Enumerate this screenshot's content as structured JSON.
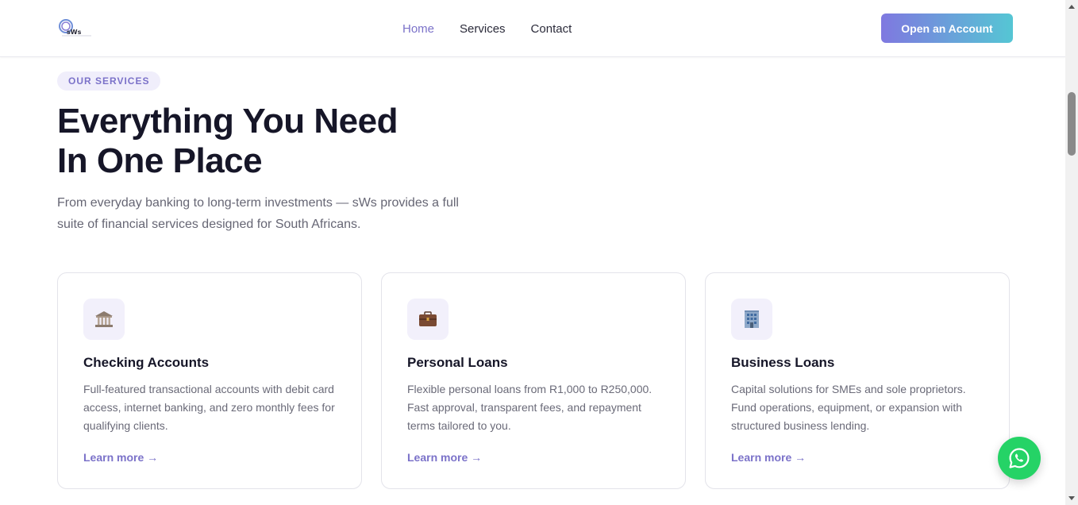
{
  "header": {
    "logo_text": "sWs",
    "nav": [
      {
        "label": "Home",
        "active": true
      },
      {
        "label": "Services",
        "active": false
      },
      {
        "label": "Contact",
        "active": false
      }
    ],
    "cta_label": "Open an Account"
  },
  "section": {
    "badge": "OUR SERVICES",
    "headline_line1": "Everything You Need",
    "headline_line2": "In One Place",
    "intro": "From everyday banking to long-term investments — sWs provides a full suite of financial services designed for South Africans."
  },
  "cards": [
    {
      "icon": "bank-icon",
      "title": "Checking Accounts",
      "description": "Full-featured transactional accounts with debit card access, internet banking, and zero monthly fees for qualifying clients.",
      "link": "Learn more →"
    },
    {
      "icon": "briefcase-icon",
      "title": "Personal Loans",
      "description": "Flexible personal loans from R1,000 to R250,000. Fast approval, transparent fees, and repayment terms tailored to you.",
      "link": "Learn more →"
    },
    {
      "icon": "office-building-icon",
      "title": "Business Loans",
      "description": "Capital solutions for SMEs and sole proprietors. Fund operations, equipment, or expansion with structured business lending.",
      "link": "Learn more →"
    }
  ],
  "floating": {
    "icon": "whatsapp-icon"
  },
  "colors": {
    "accent": "#7b72c9",
    "cta_gradient_start": "#7f78e0",
    "cta_gradient_end": "#55c6d4",
    "whatsapp": "#25d366",
    "heading": "#161628"
  }
}
